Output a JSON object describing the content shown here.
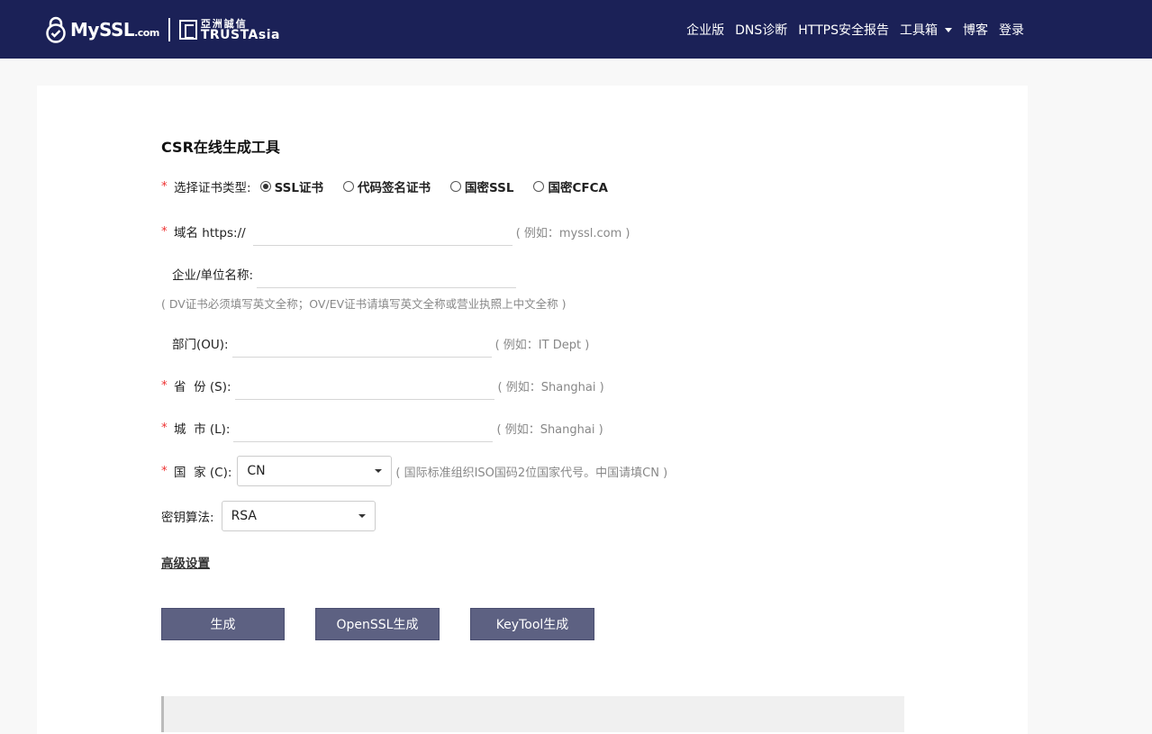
{
  "header": {
    "logo_text": "MySSL",
    "logo_suffix": ".com",
    "partner_cn": "亞洲誠信",
    "partner_en": "TRUSTAsia",
    "nav": [
      {
        "label": "企业版"
      },
      {
        "label": "DNS诊断"
      },
      {
        "label": "HTTPS安全报告"
      },
      {
        "label": "工具箱"
      },
      {
        "label": "博客"
      },
      {
        "label": "登录"
      }
    ]
  },
  "form": {
    "title": "CSR在线生成工具",
    "cert_type_label": "选择证书类型:",
    "cert_types": [
      {
        "label": "SSL证书",
        "selected": true
      },
      {
        "label": "代码签名证书",
        "selected": false
      },
      {
        "label": "国密SSL",
        "selected": false
      },
      {
        "label": "国密CFCA",
        "selected": false
      }
    ],
    "domain_label": "域名 https://",
    "domain_value": "",
    "domain_hint": "( 例如：myssl.com )",
    "org_label": "企业/单位名称:",
    "org_value": "",
    "org_hint": "( DV证书必须填写英文全称；OV/EV证书请填写英文全称或营业执照上中文全称 )",
    "ou_label": "部门(OU):",
    "ou_value": "",
    "ou_hint": "( 例如：IT Dept )",
    "state_label": "省  份 (S):",
    "state_value": "",
    "state_hint": "( 例如：Shanghai )",
    "city_label": "城  市 (L):",
    "city_value": "",
    "city_hint": "( 例如：Shanghai )",
    "country_label": "国  家 (C):",
    "country_value": "CN",
    "country_hint": "( 国际标准组织ISO国码2位国家代号。中国请填CN )",
    "algo_label": "密钥算法:",
    "algo_value": "RSA",
    "advanced_label": "高级设置",
    "buttons": {
      "generate": "生成",
      "openssl": "OpenSSL生成",
      "keytool": "KeyTool生成"
    },
    "required_mark": "*"
  },
  "colors": {
    "header_bg": "#1b2157",
    "button_bg": "#5d6182",
    "required": "#e33333"
  }
}
